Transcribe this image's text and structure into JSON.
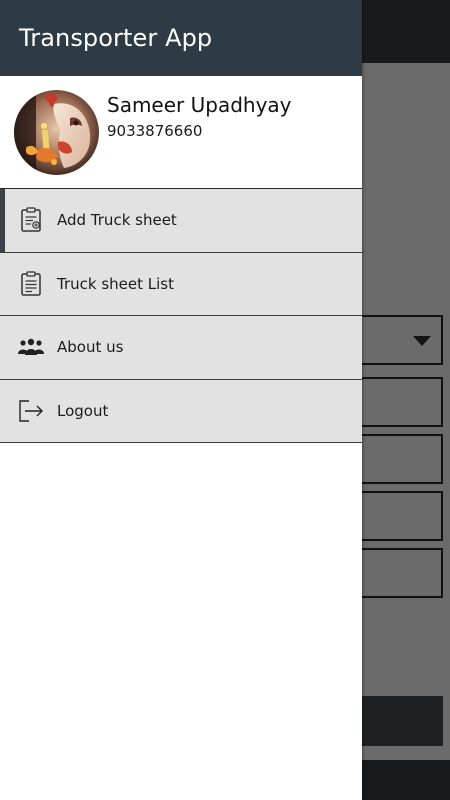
{
  "app": {
    "title": "Transporter App"
  },
  "profile": {
    "name": "Sameer Upadhyay",
    "phone": "9033876660"
  },
  "menu": {
    "items": [
      {
        "label": "Add Truck sheet",
        "icon": "clipboard-add-icon",
        "active": true
      },
      {
        "label": "Truck sheet List",
        "icon": "clipboard-list-icon",
        "active": false
      },
      {
        "label": "About us",
        "icon": "group-icon",
        "active": false
      },
      {
        "label": "Logout",
        "icon": "logout-icon",
        "active": false
      }
    ]
  },
  "colors": {
    "appbar": "#2f3b44",
    "menu_item_bg": "#e2e2e2",
    "active_indicator": "#3a434a",
    "scrim": "#6b6b6b"
  }
}
